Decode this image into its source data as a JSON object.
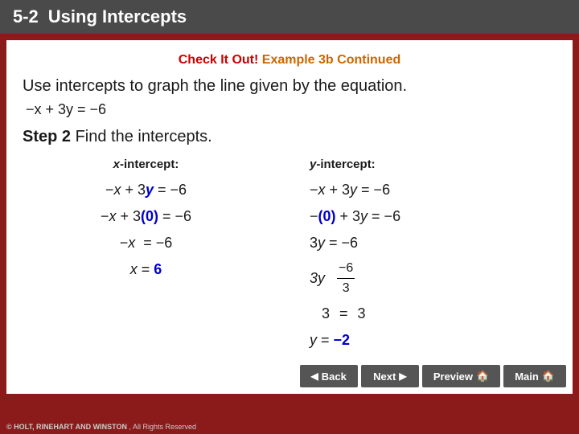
{
  "header": {
    "number": "5-2",
    "title": "Using Intercepts"
  },
  "check_it_out": {
    "check_label": "Check It Out!",
    "example_label": "Example 3b Continued"
  },
  "instruction": "Use intercepts to graph the line given by the equation.",
  "equation": "−x + 3y = −6",
  "step": {
    "number": "2",
    "text": "Find the intercepts."
  },
  "x_intercept": {
    "header": "x-intercept:",
    "lines": [
      "−x + 3y = −6",
      "−x + 3(0) = −6",
      "−x  = −6",
      "x = 6"
    ]
  },
  "y_intercept": {
    "header": "y-intercept:",
    "lines": [
      "−x + 3y = −6",
      "−(0) + 3y = −6",
      "3y = −6",
      "3y   −6",
      "3  =  3",
      "y = −2"
    ]
  },
  "nav": {
    "back_label": "Back",
    "next_label": "Next",
    "preview_label": "Preview",
    "main_label": "Main"
  },
  "copyright": "© HOLT, RINEHART AND WINSTON, All Rights Reserved"
}
